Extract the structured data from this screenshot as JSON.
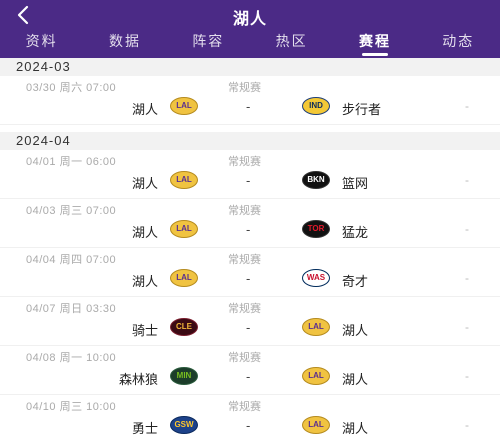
{
  "header": {
    "title": "湖人",
    "tabs": [
      {
        "label": "资料"
      },
      {
        "label": "数据"
      },
      {
        "label": "阵容"
      },
      {
        "label": "热区"
      },
      {
        "label": "赛程"
      },
      {
        "label": "动态"
      }
    ],
    "active_tab": "赛程"
  },
  "months": [
    {
      "label": "2024-03",
      "games": [
        {
          "time": "03/30  周六 07:00",
          "type": "常规赛",
          "home": "湖人",
          "home_logo": "LAL",
          "vs": "-",
          "away": "步行者",
          "away_logo": "IND",
          "score": "-"
        }
      ]
    },
    {
      "label": "2024-04",
      "games": [
        {
          "time": "04/01  周一 06:00",
          "type": "常规赛",
          "home": "湖人",
          "home_logo": "LAL",
          "vs": "-",
          "away": "篮网",
          "away_logo": "BKN",
          "score": "-"
        },
        {
          "time": "04/03  周三 07:00",
          "type": "常规赛",
          "home": "湖人",
          "home_logo": "LAL",
          "vs": "-",
          "away": "猛龙",
          "away_logo": "TOR",
          "score": "-"
        },
        {
          "time": "04/04  周四 07:00",
          "type": "常规赛",
          "home": "湖人",
          "home_logo": "LAL",
          "vs": "-",
          "away": "奇才",
          "away_logo": "WAS",
          "score": "-"
        },
        {
          "time": "04/07  周日 03:30",
          "type": "常规赛",
          "home": "骑士",
          "home_logo": "CLE",
          "vs": "-",
          "away": "湖人",
          "away_logo": "LAL",
          "score": "-"
        },
        {
          "time": "04/08  周一 10:00",
          "type": "常规赛",
          "home": "森林狼",
          "home_logo": "MIN",
          "vs": "-",
          "away": "湖人",
          "away_logo": "LAL",
          "score": "-"
        },
        {
          "time": "04/10  周三 10:00",
          "type": "常规赛",
          "home": "勇士",
          "home_logo": "GSW",
          "vs": "-",
          "away": "湖人",
          "away_logo": "LAL",
          "score": "-"
        }
      ]
    }
  ],
  "colors": {
    "header_bg": "#4b2a86",
    "month_bg": "#f2f2f2"
  }
}
